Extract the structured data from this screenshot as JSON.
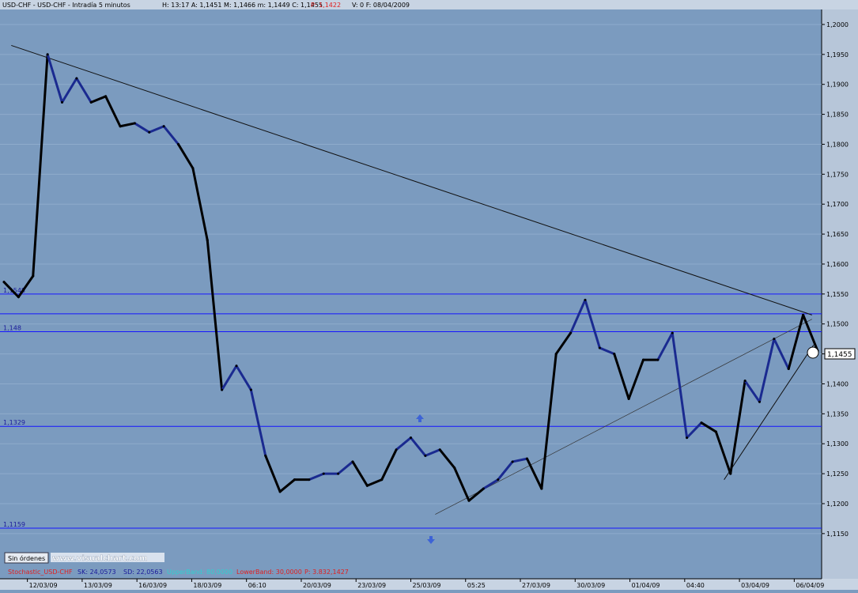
{
  "header": {
    "symbol": "USD-CHF - USD-CHF - Intradía 5 minutos",
    "values": "H: 13:17  A: 1,1451  M: 1,1466  m: 1,1449  C: 1,1455",
    "p_label": "P: 1,1422",
    "tail": "V: 0  F: 08/04/2009"
  },
  "footer": {
    "orders_button": "Sin órdenes",
    "watermark": "www.visualchart.com",
    "indicator": {
      "name": "Stochastic_USD-CHF",
      "sk": "SK: 24,0573",
      "sd": "SD: 22,0563",
      "upper": "UpperBand: 80,0000",
      "lower": "LowerBand: 30,0000",
      "p": "P: 3.832,1427"
    }
  },
  "last_price_tag": "1,1455",
  "colors": {
    "background": "#7b9bbf",
    "price_blue": "#1a2a90",
    "price_black": "#000000",
    "hline": "#1515ff",
    "trendline": "#111111"
  },
  "chart_data": {
    "type": "line",
    "title": "",
    "xlabel": "",
    "ylabel": "",
    "ylim": [
      1.113,
      1.2025
    ],
    "y_ticks": [
      "1,1150",
      "1,1200",
      "1,1250",
      "1,1300",
      "1,1350",
      "1,1400",
      "1,1450",
      "1,1500",
      "1,1550",
      "1,1600",
      "1,1650",
      "1,1700",
      "1,1750",
      "1,1800",
      "1,1850",
      "1,1900",
      "1,1950",
      "1,2000"
    ],
    "y_tick_values": [
      1.115,
      1.12,
      1.125,
      1.13,
      1.135,
      1.14,
      1.145,
      1.15,
      1.155,
      1.16,
      1.165,
      1.17,
      1.175,
      1.18,
      1.185,
      1.19,
      1.195,
      1.2
    ],
    "x_tick_labels": [
      "12/03/09",
      "13/03/09",
      "16/03/09",
      "18/03/09",
      "06:10",
      "20/03/09",
      "23/03/09",
      "25/03/09",
      "05:25",
      "27/03/09",
      "30/03/09",
      "01/04/09",
      "04:40",
      "03/04/09",
      "06/04/09"
    ],
    "x": [
      0,
      2,
      4,
      6,
      8,
      10,
      12,
      14,
      16,
      18,
      20,
      22,
      24,
      26,
      28,
      30,
      32,
      34,
      36,
      38,
      40,
      42,
      44,
      46,
      48,
      50,
      52,
      54,
      56,
      58,
      60,
      62,
      64,
      66,
      68,
      70,
      72,
      74,
      76,
      78,
      80,
      82,
      84,
      86,
      88,
      90,
      92,
      94,
      96,
      98,
      100
    ],
    "series": [
      {
        "values": [
          1.157,
          1.1545,
          1.158,
          1.195,
          1.187,
          1.191,
          1.187,
          1.188,
          1.183,
          1.1835,
          1.182,
          1.183,
          1.18,
          1.176,
          1.164,
          1.139,
          1.143,
          1.139,
          1.128,
          1.122,
          1.124,
          1.124,
          1.125,
          1.125,
          1.127,
          1.123,
          1.124,
          1.129,
          1.131,
          1.128,
          1.129,
          1.126,
          1.1205,
          1.1225,
          1.124,
          1.127,
          1.1275,
          1.1225,
          1.145,
          1.1485,
          1.154,
          1.146,
          1.145,
          1.1375,
          1.144,
          1.144,
          1.1485,
          1.131,
          1.1335,
          1.132,
          1.125,
          1.1405,
          1.137,
          1.1475,
          1.1425,
          1.1515,
          1.1455
        ]
      }
    ],
    "horizontal_levels": [
      {
        "label": "1,1548",
        "value": 1.155
      },
      {
        "label": "",
        "value": 1.1517
      },
      {
        "label": "1,148",
        "value": 1.1487
      },
      {
        "label": "1,1329",
        "value": 1.1329
      },
      {
        "label": "1,1159",
        "value": 1.1159
      }
    ],
    "trendlines": [
      {
        "from": [
          0.9,
          1.1965
        ],
        "to": [
          99.3,
          1.1515
        ]
      },
      {
        "from": [
          53.0,
          1.1182
        ],
        "to": [
          99.3,
          1.1508
        ]
      },
      {
        "from": [
          88.5,
          1.124
        ],
        "to": [
          99.5,
          1.1465
        ]
      }
    ],
    "grid": true,
    "legend": "none"
  }
}
